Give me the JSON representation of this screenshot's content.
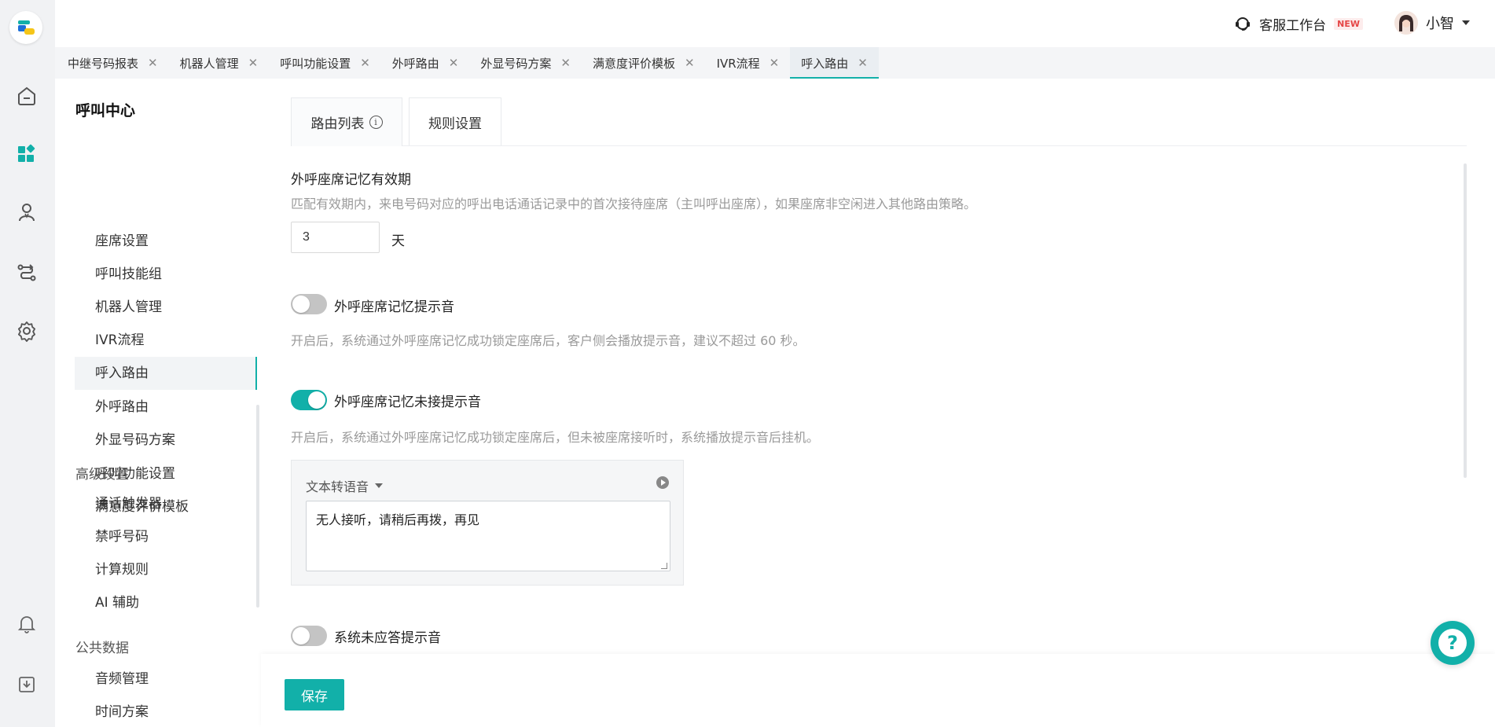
{
  "topbar": {
    "workspace_label": "客服工作台",
    "new_badge": "NEW",
    "user_name": "小智"
  },
  "tabs": [
    {
      "label": "中继号码报表"
    },
    {
      "label": "机器人管理"
    },
    {
      "label": "呼叫功能设置"
    },
    {
      "label": "外呼路由"
    },
    {
      "label": "外显号码方案"
    },
    {
      "label": "满意度评价模板"
    },
    {
      "label": "IVR流程"
    },
    {
      "label": "呼入路由",
      "active": true
    }
  ],
  "sidebar": {
    "title": "呼叫中心",
    "items": [
      {
        "label": "座席设置"
      },
      {
        "label": "呼叫技能组"
      },
      {
        "label": "机器人管理"
      },
      {
        "label": "IVR流程"
      },
      {
        "label": "呼入路由",
        "active": true
      },
      {
        "label": "外呼路由"
      },
      {
        "label": "外显号码方案"
      },
      {
        "label": "呼叫功能设置"
      },
      {
        "label": "满意度评价模板"
      }
    ],
    "group_advanced": "高级设置",
    "advanced_items": [
      {
        "label": "通话触发器"
      },
      {
        "label": "禁呼号码"
      },
      {
        "label": "计算规则"
      },
      {
        "label": "AI 辅助"
      }
    ],
    "group_public": "公共数据",
    "public_items": [
      {
        "label": "音频管理"
      },
      {
        "label": "时间方案"
      }
    ]
  },
  "page_tabs": {
    "route_list": "路由列表",
    "rule_settings": "规则设置",
    "active": "rule_settings"
  },
  "memory_validity": {
    "label": "外呼座席记忆有效期",
    "hint": "匹配有效期内，来电号码对应的呼出电话通话记录中的首次接待座席（主叫呼出座席），如果座席非空闲进入其他路由策略。",
    "value": "3",
    "unit": "天"
  },
  "memory_tone": {
    "label": "外呼座席记忆提示音",
    "enabled": false,
    "hint": "开启后，系统通过外呼座席记忆成功锁定座席后，客户侧会播放提示音，建议不超过 60 秒。"
  },
  "memory_unanswered": {
    "label": "外呼座席记忆未接提示音",
    "enabled": true,
    "hint": "开启后，系统通过外呼座席记忆成功锁定座席后，但未被座席接听时，系统播放提示音后挂机。",
    "tts_mode": "文本转语音",
    "tts_text": "无人接听，请稍后再拨，再见"
  },
  "system_unanswered": {
    "label": "系统未应答提示音",
    "enabled": false
  },
  "footer": {
    "save_label": "保存"
  },
  "colors": {
    "accent": "#12b0a9"
  }
}
